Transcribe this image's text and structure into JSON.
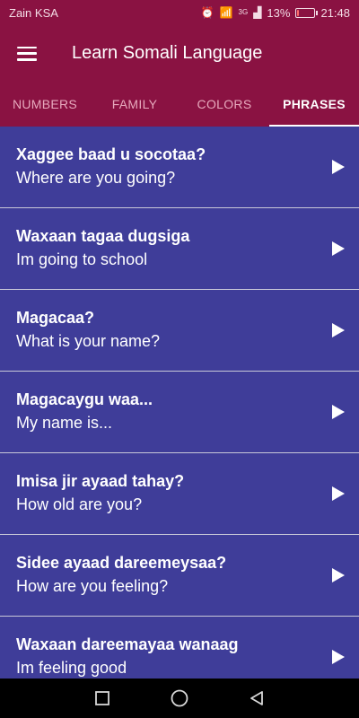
{
  "status_bar": {
    "carrier": "Zain KSA",
    "signal_label": "3G",
    "battery_percent": "13%",
    "battery_level": 0.13,
    "time": "21:48"
  },
  "toolbar": {
    "title": "Learn Somali Language"
  },
  "tabs": [
    {
      "label": "NUMBERS",
      "active": false
    },
    {
      "label": "FAMILY",
      "active": false
    },
    {
      "label": "COLORS",
      "active": false
    },
    {
      "label": "PHRASES",
      "active": true
    }
  ],
  "phrases": [
    {
      "somali": "Xaggee baad u socotaa?",
      "english": "Where are you going?"
    },
    {
      "somali": "Waxaan tagaa dugsiga",
      "english": "Im going to school"
    },
    {
      "somali": "Magacaa?",
      "english": "What is your name?"
    },
    {
      "somali": "Magacaygu waa...",
      "english": "My name is..."
    },
    {
      "somali": "Imisa jir ayaad tahay?",
      "english": "How old are you?"
    },
    {
      "somali": "Sidee ayaad dareemeysaa?",
      "english": "How are you feeling?"
    },
    {
      "somali": "Waxaan dareemayaa wanaag",
      "english": "Im feeling good"
    }
  ],
  "colors": {
    "primary": "#8a1242",
    "list_background": "#3f3d99",
    "tab_inactive": "#e7a9bd",
    "text": "#ffffff"
  },
  "icons": {
    "menu": "hamburger-menu-icon",
    "play": "play-triangle-icon",
    "nav_recent": "square-icon",
    "nav_home": "circle-icon",
    "nav_back": "triangle-back-icon"
  }
}
